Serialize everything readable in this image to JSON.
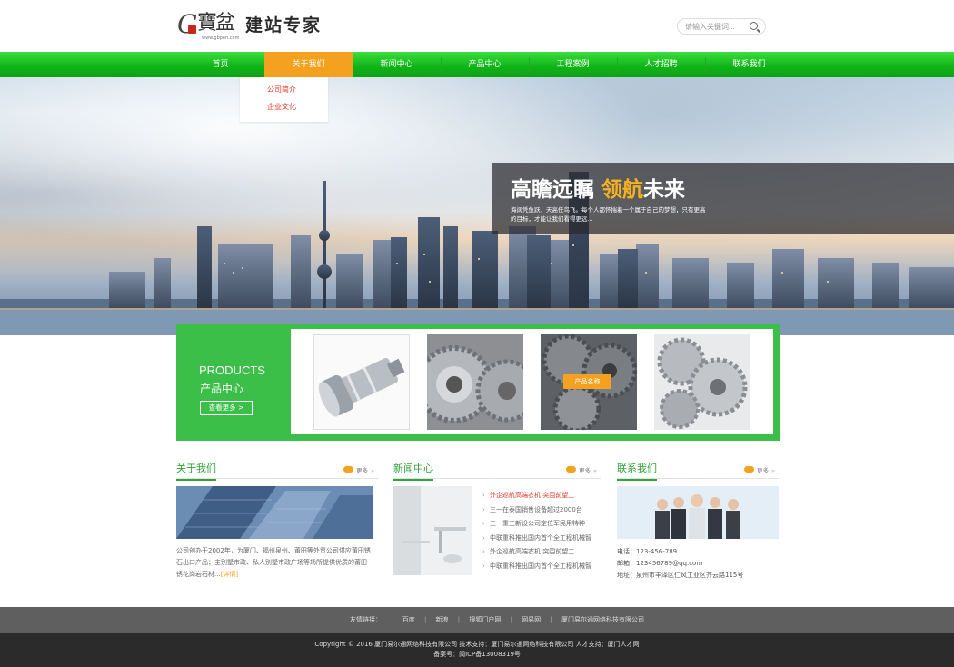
{
  "header": {
    "logo_letter": "G",
    "logo_calligraphy": "寶盆",
    "logo_title": "建站专家",
    "logo_url": "www.gbpen.com",
    "search_placeholder": "请输入关键词..."
  },
  "nav": {
    "items": [
      "首页",
      "关于我们",
      "新闻中心",
      "产品中心",
      "工程案例",
      "人才招聘",
      "联系我们"
    ],
    "active_index": 1,
    "dropdown": [
      "公司简介",
      "企业文化"
    ]
  },
  "banner": {
    "slogan_part1": "高瞻远瞩 ",
    "slogan_highlight": "领航",
    "slogan_part2": "未来",
    "subtext": "海阔凭鱼跃，天高任鸟飞。每个人都怀揣着一个属于自己的梦想，只有更高的目标，才能让我们看得更远..."
  },
  "products": {
    "title_en": "PRODUCTS",
    "title_zh": "产品中心",
    "more_label": "查看更多 >",
    "hover_tag": "产品名称"
  },
  "about": {
    "title": "关于我们",
    "more": "更多",
    "text": "公司创办于2002年，为厦门、福州泉州、莆田等外贸公司供应莆田锈石出口产品；主别墅市政、私人别墅市政广场等场所提供优质的莆田锈花岗岩石材...",
    "detail_link": "[详情]"
  },
  "news": {
    "title": "新闻中心",
    "more": "更多",
    "items": [
      "外企巡航高端农机 突围前望工",
      "三一在泰国销售设备超过2000台",
      "三一重工新设公司定位军民用特种",
      "中联重科推出国内首个全工程机械智",
      "外企巡航高端农机 突围前望工",
      "中联重科推出国内首个全工程机械智"
    ]
  },
  "contact": {
    "title": "联系我们",
    "more": "更多",
    "phone": "电话：123-456-789",
    "email": "邮箱：123456789@qq.com",
    "address": "地址：泉州市丰泽区仁风工业区齐云路115号"
  },
  "footer": {
    "links_label": "友情链接：",
    "links": [
      "百度",
      "新浪",
      "搜狐门户网",
      "网易网",
      "厦门易尔通网络科技有限公司"
    ],
    "copyright": "Copyright © 2016 厦门易尔通网络科技有限公司 技术支持：厦门易尔通网络科技有限公司 人才支持：厦门人才网",
    "icp": "备案号：闽ICP备13008319号"
  },
  "colors": {
    "nav_green": "#12b51a",
    "accent_orange": "#f4a11f",
    "section_green": "#2fa43a",
    "product_green": "#3cbf49"
  }
}
